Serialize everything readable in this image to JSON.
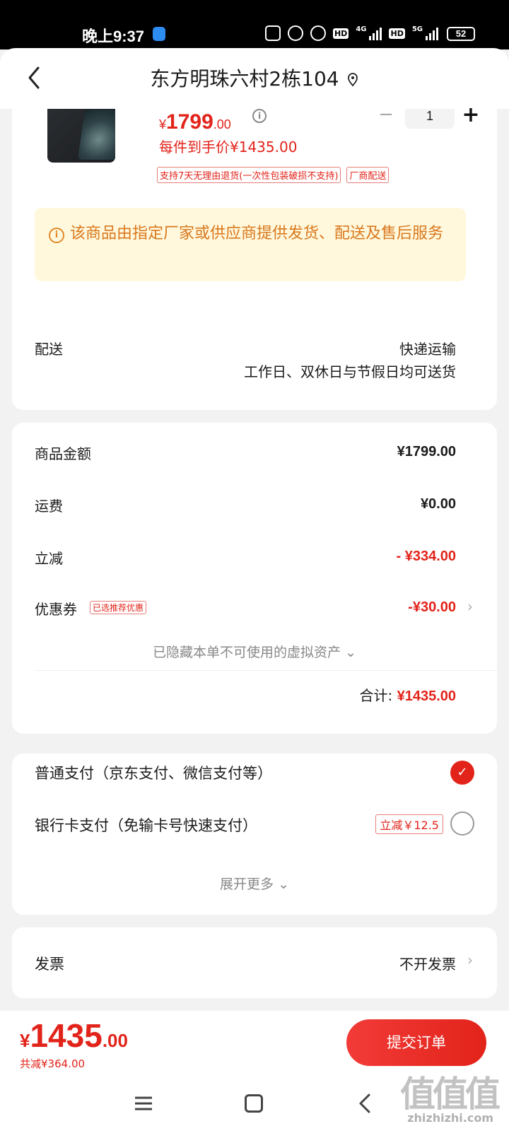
{
  "status_bar": {
    "time": "晚上9:37",
    "network_4g": "4G",
    "network_5g": "5G",
    "hd": "HD",
    "battery": "52"
  },
  "header": {
    "title": "东方明珠六村2栋104"
  },
  "product": {
    "price_currency": "¥",
    "price_int": "1799",
    "price_dec": ".00",
    "quantity": "1",
    "net_price": "每件到手价¥1435.00",
    "tags": [
      "支持7天无理由退货(一次性包装破损不支持)",
      "厂商配送"
    ]
  },
  "notice": {
    "text": "该商品由指定厂家或供应商提供发货、配送及售后服务"
  },
  "shipping": {
    "label": "配送",
    "method": "快递运输",
    "note": "工作日、双休日与节假日均可送货"
  },
  "amounts": {
    "goods_label": "商品金额",
    "goods_value": "¥1799.00",
    "freight_label": "运费",
    "freight_value": "¥0.00",
    "discount_label": "立减",
    "discount_value": "- ¥334.00",
    "coupon_label": "优惠券",
    "coupon_tag": "已选推荐优惠",
    "coupon_value": "-¥30.00",
    "hidden_assets": "已隐藏本单不可使用的虚拟资产",
    "total_label": "合计:",
    "total_value": "¥1435.00"
  },
  "payment": {
    "normal_label": "普通支付（京东支付、微信支付等）",
    "bank_label": "银行卡支付（免输卡号快速支付）",
    "bank_tag": "立减￥12.5",
    "expand": "展开更多"
  },
  "invoice": {
    "label": "发票",
    "value": "不开发票"
  },
  "bottom": {
    "currency": "¥",
    "price_int": "1435",
    "price_dec": ".00",
    "saved": "共减¥364.00",
    "submit": "提交订单"
  },
  "watermark": {
    "logo": "值值值",
    "site": "zhizhizhi.com"
  },
  "colors": {
    "accent": "#e2231a",
    "notice_bg": "#fff8dc",
    "notice_text": "#d9781d"
  }
}
